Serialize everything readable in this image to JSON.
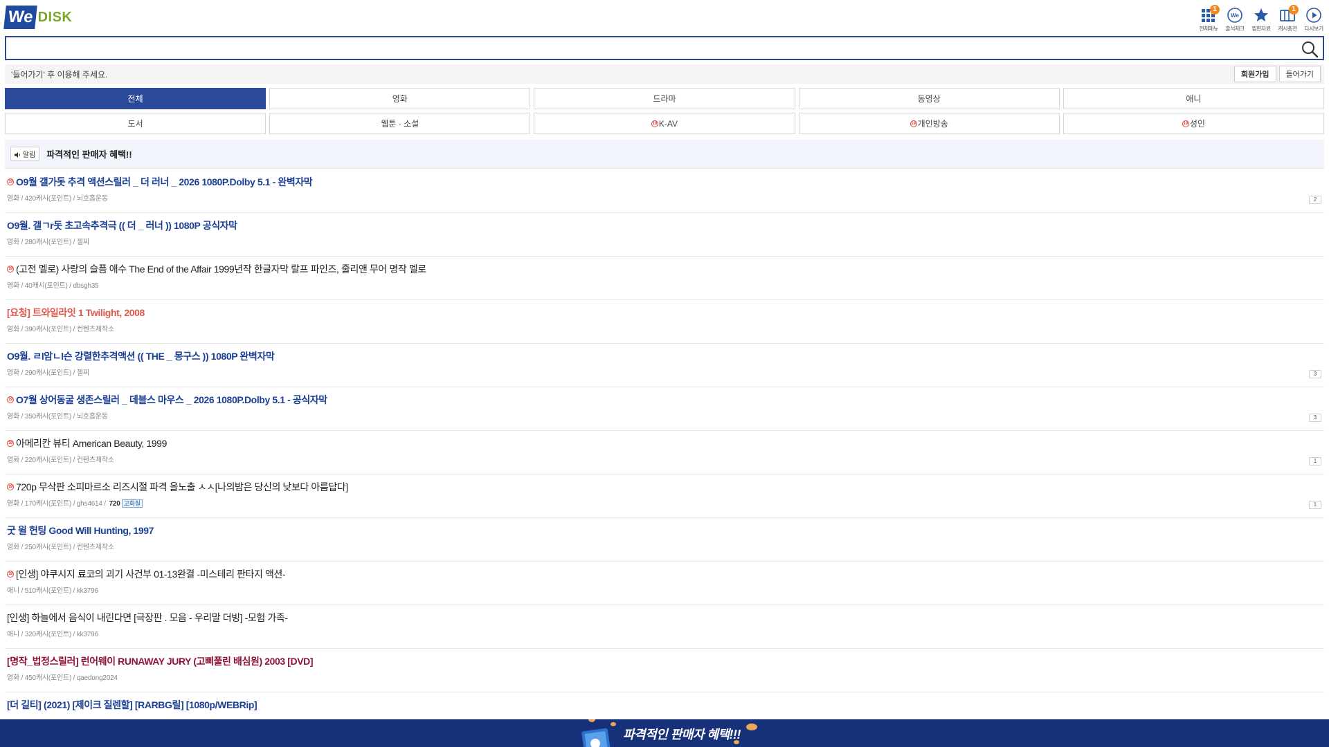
{
  "logo": {
    "we": "We",
    "disk": "DISK"
  },
  "top_icons": [
    {
      "label": "전체메뉴",
      "icon": "grid-menu-icon",
      "badge": "1"
    },
    {
      "label": "출석체크",
      "icon": "attendance-icon",
      "badge": ""
    },
    {
      "label": "찜한자료",
      "icon": "star-icon",
      "badge": ""
    },
    {
      "label": "캐시충전",
      "icon": "cash-charge-icon",
      "badge": "1"
    },
    {
      "label": "다시보기",
      "icon": "replay-icon",
      "badge": ""
    }
  ],
  "search": {
    "value": "",
    "placeholder": ""
  },
  "login_bar": {
    "notice": "'들어가기' 후 이용해 주세요.",
    "join_label": "회원가입",
    "login_label": "들어가기"
  },
  "categories": [
    {
      "label": "전체",
      "active": true,
      "adult": false
    },
    {
      "label": "영화",
      "active": false,
      "adult": false
    },
    {
      "label": "드라마",
      "active": false,
      "adult": false
    },
    {
      "label": "동영상",
      "active": false,
      "adult": false
    },
    {
      "label": "애니",
      "active": false,
      "adult": false
    },
    {
      "label": "도서",
      "active": false,
      "adult": false
    },
    {
      "label": "웹툰 · 소설",
      "active": false,
      "adult": false
    },
    {
      "label": "K-AV",
      "active": false,
      "adult": true
    },
    {
      "label": "개인방송",
      "active": false,
      "adult": true
    },
    {
      "label": "성인",
      "active": false,
      "adult": true
    }
  ],
  "notice": {
    "tag": "알림",
    "title": "파격적인 판매자 혜택!!"
  },
  "items": [
    {
      "title": "O9월 갤가돗 추격 액션스릴러 _ 더 러너 _ 2026 1080P.Dolby 5.1 - 완벽자막",
      "style": "blue",
      "adult": true,
      "meta": "영화 / 420캐시(포인트) / 뇌호흡운동",
      "comments": "2"
    },
    {
      "title": "O9월. 갤ㄱr돗 초고속추격극 (( 더 _ 러너 )) 1080P 공식자막",
      "style": "blue",
      "adult": false,
      "meta": "영화 / 280캐시(포인트) / 젤찌",
      "comments": ""
    },
    {
      "title": "(고전 멜로) 사랑의 슬픔 애수 The End of the Affair 1999년작 한글자막 랄프 파인즈, 줄리앤 무어 명작 멜로",
      "style": "dark",
      "adult": true,
      "meta": "영화 / 40캐시(포인트) / dbsgh35",
      "comments": ""
    },
    {
      "title": "[요청] 트와일라잇 1 Twilight, 2008",
      "style": "red",
      "adult": false,
      "meta": "영화 / 390캐시(포인트) / 컨텐츠제작소",
      "comments": ""
    },
    {
      "title": "O9월. ㄹl암ㄴl슨 강렬한추격액션 (( THE _ 몽구스 )) 1080P 완벽자막",
      "style": "blue",
      "adult": false,
      "meta": "영화 / 290캐시(포인트) / 젤찌",
      "comments": "3"
    },
    {
      "title": "O7월 상어동굴 생존스릴러 _ 데블스 마우스 _ 2026 1080P.Dolby 5.1 - 공식자막",
      "style": "blue",
      "adult": true,
      "meta": "영화 / 350캐시(포인트) / 뇌호흡운동",
      "comments": "3"
    },
    {
      "title": "아메리칸 뷰티 American Beauty, 1999",
      "style": "dark",
      "adult": true,
      "meta": "영화 / 220캐시(포인트) / 컨텐츠제작소",
      "comments": "1"
    },
    {
      "title": "720p 무삭판 소피마르소 리즈시절 파격 올노출 ㅅㅅ[나의밤은 당신의 낮보다 아름답다]",
      "style": "dark",
      "adult": true,
      "meta": "영화 / 170캐시(포인트) / ghs4614 / ",
      "quality": "720",
      "quality_tag": "고화질",
      "comments": "1"
    },
    {
      "title": "굿 윌 헌팅 Good Will Hunting, 1997",
      "style": "blue",
      "adult": false,
      "meta": "영화 / 250캐시(포인트) / 컨텐츠제작소",
      "comments": ""
    },
    {
      "title": "[인생] 야쿠시지 료코의 괴기 사건부 01-13완결 -미스테리 판타지 액션-",
      "style": "dark",
      "adult": true,
      "meta": "애니 / 510캐시(포인트) / kk3796",
      "comments": ""
    },
    {
      "title": "[인생] 하늘에서 음식이 내린다면 [극장판 . 모음 - 우리말 더빙] -모험 가족-",
      "style": "dark",
      "adult": false,
      "meta": "애니 / 320캐시(포인트) / kk3796",
      "comments": ""
    },
    {
      "title": "[명작_법정스릴러] 런어웨이 RUNAWAY JURY (고삐풀린 배심원) 2003 [DVD]",
      "style": "maroon",
      "adult": false,
      "meta": "영화 / 450캐시(포인트) / qaedong2024",
      "comments": ""
    },
    {
      "title": "[더 길티] (2021) [제이크 질렌할] [RARBG릴] [1080p/WEBRip]",
      "style": "blue",
      "adult": false,
      "meta": "",
      "comments": ""
    }
  ],
  "bottom_banner": {
    "text": "파격적인 판매자 혜택!!!"
  },
  "adult_mark": "19",
  "colors": {
    "brand_blue": "#1f4aa0",
    "active_tab": "#2b4a9c",
    "badge_orange": "#f08a1c",
    "banner_bg": "#17307a",
    "logo_green": "#7aa72a"
  }
}
